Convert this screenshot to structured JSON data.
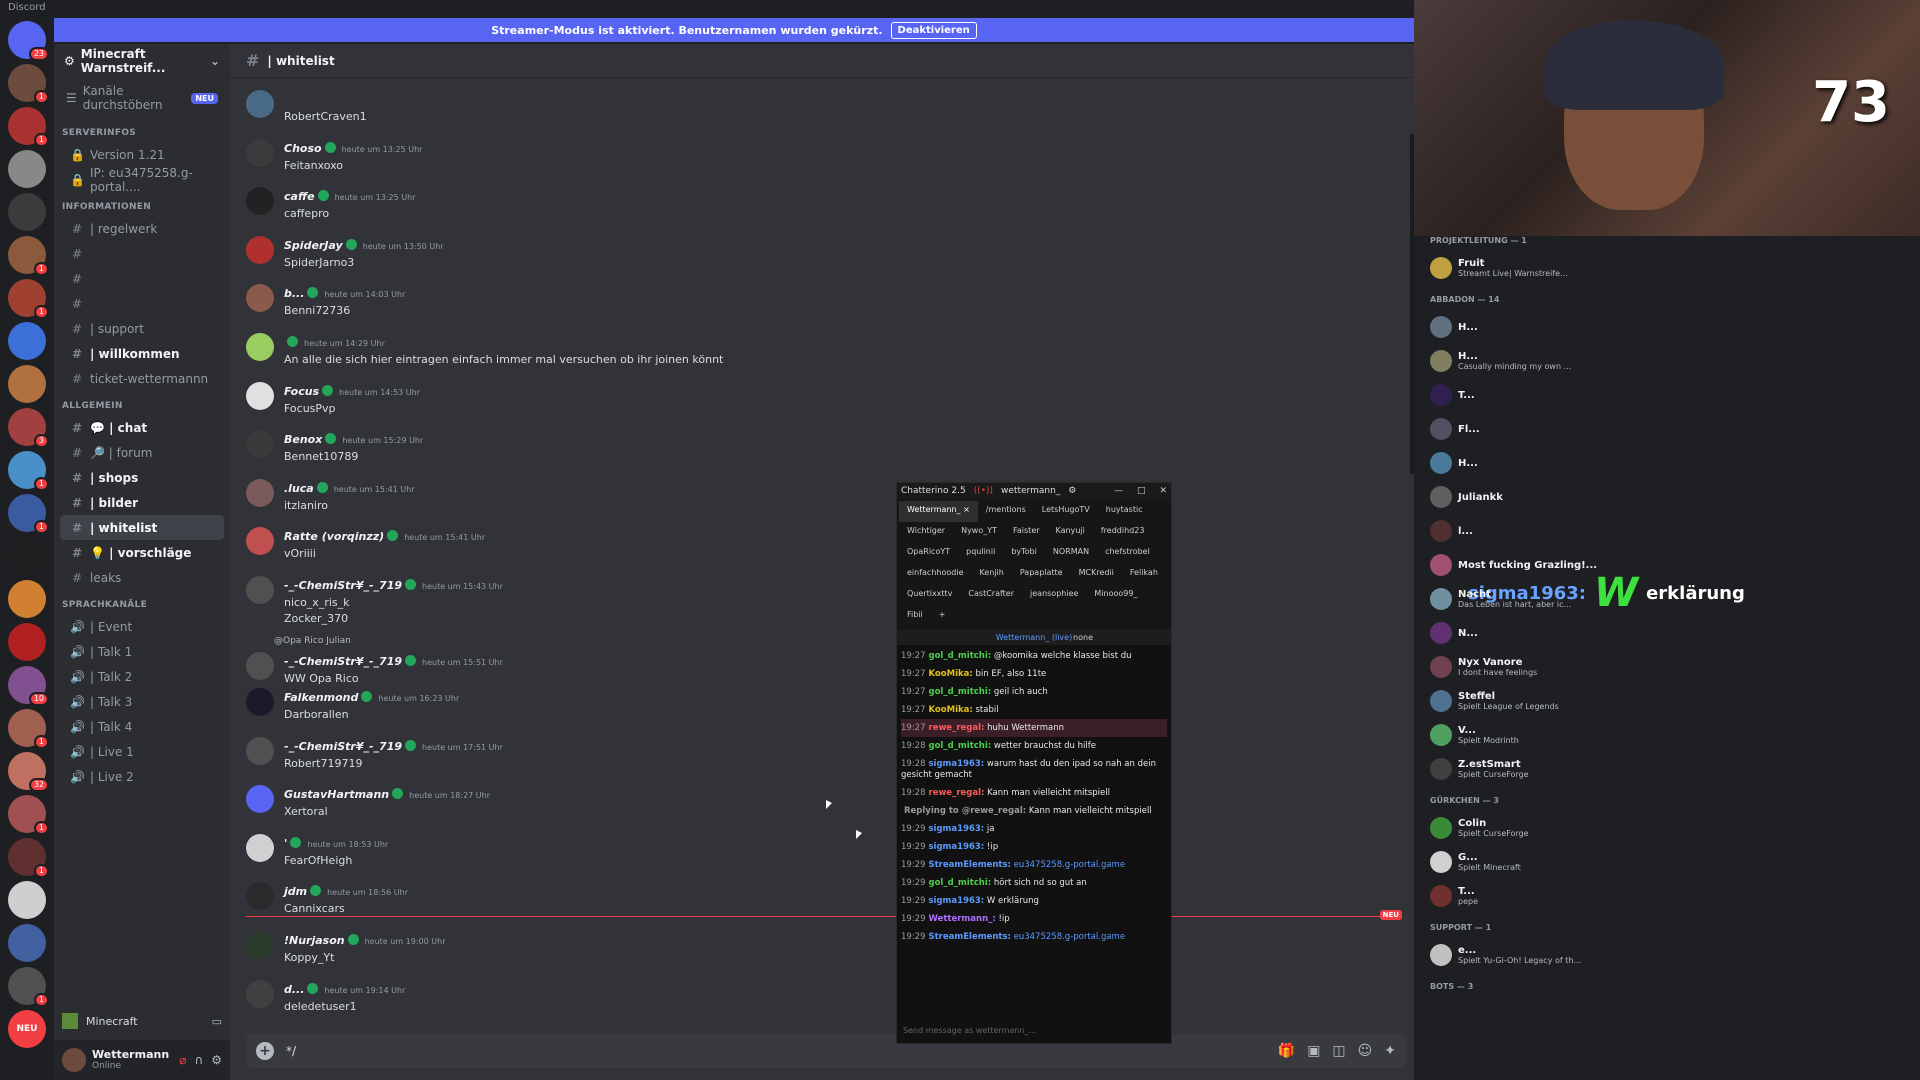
{
  "window": {
    "title": "Discord"
  },
  "banner": {
    "text": "Streamer-Modus ist aktiviert. Benutzernamen wurden gekürzt.",
    "button": "Deaktivieren"
  },
  "servers": [
    {
      "badge": "23",
      "color": "#5865f2"
    },
    {
      "badge": "1",
      "color": "#6d4c3d"
    },
    {
      "badge": "1",
      "color": "#a83232"
    },
    {
      "badge": "",
      "color": "#888888"
    },
    {
      "badge": "",
      "color": "#3b3b3b"
    },
    {
      "badge": "1",
      "color": "#8b5a3c"
    },
    {
      "badge": "1",
      "color": "#a04030"
    },
    {
      "badge": "",
      "color": "#3c6fd8"
    },
    {
      "badge": "",
      "color": "#b07040"
    },
    {
      "badge": "3",
      "color": "#a04040"
    },
    {
      "badge": "1",
      "color": "#4a90c8"
    },
    {
      "badge": "1",
      "color": "#3b5ba0"
    },
    {
      "badge": "",
      "color": "#202020"
    },
    {
      "badge": "",
      "color": "#d08030"
    },
    {
      "badge": "",
      "color": "#b02020"
    },
    {
      "badge": "10",
      "color": "#805090"
    },
    {
      "badge": "1",
      "color": "#a06050"
    },
    {
      "badge": "32",
      "color": "#c07060"
    },
    {
      "badge": "1",
      "color": "#a05050"
    },
    {
      "badge": "1",
      "color": "#603030"
    },
    {
      "badge": "",
      "color": "#cfcfcf"
    },
    {
      "badge": "",
      "color": "#4060a0"
    },
    {
      "badge": "1",
      "color": "#505050"
    }
  ],
  "servers_bottom": {
    "neu": "NEU"
  },
  "sidebar": {
    "guild_name": "Minecraft Warnstreif...",
    "browse_label": "Kanäle durchstöbern",
    "browse_tag": "NEU",
    "categories": [
      {
        "name": "SERVERINFOS",
        "channels": [
          {
            "prefix": "🔒",
            "label": "Version 1.21"
          },
          {
            "prefix": "🔒",
            "label": "IP: eu3475258.g-portal...."
          }
        ]
      },
      {
        "name": "INFORMATIONEN",
        "channels": [
          {
            "prefix": "#",
            "label": "| regelwerk"
          },
          {
            "prefix": "#",
            "label": ""
          },
          {
            "prefix": "#",
            "label": ""
          },
          {
            "prefix": "#",
            "label": ""
          },
          {
            "prefix": "#",
            "label": "| support"
          },
          {
            "prefix": "#",
            "label": "| willkommen"
          },
          {
            "prefix": "#",
            "label": "ticket-wettermannn"
          }
        ]
      },
      {
        "name": "ALLGEMEIN",
        "channels": [
          {
            "prefix": "#",
            "label": "💬 | chat"
          },
          {
            "prefix": "#",
            "label": "🔎 | forum"
          },
          {
            "prefix": "#",
            "label": "| shops"
          },
          {
            "prefix": "#",
            "label": "| bilder"
          },
          {
            "prefix": "#",
            "label": "| whitelist"
          },
          {
            "prefix": "#",
            "label": "💡 | vorschläge"
          },
          {
            "prefix": "#",
            "label": "leaks"
          }
        ]
      },
      {
        "name": "SPRACHKANÄLE",
        "channels": [
          {
            "prefix": "🔊",
            "label": "| Event"
          },
          {
            "prefix": "🔊",
            "label": "| Talk 1"
          },
          {
            "prefix": "🔊",
            "label": "| Talk 2"
          },
          {
            "prefix": "🔊",
            "label": "| Talk 3"
          },
          {
            "prefix": "🔊",
            "label": "| Talk 4"
          },
          {
            "prefix": "🔊",
            "label": "| Live 1"
          },
          {
            "prefix": "🔊",
            "label": "| Live 2"
          }
        ]
      }
    ],
    "voice_label": "Minecraft",
    "user": {
      "name": "Wettermann",
      "status": "Online"
    }
  },
  "channel": {
    "name": "| whitelist"
  },
  "messages": [
    {
      "author": "",
      "time": "",
      "text": "RobertCraven1",
      "color": "#4a6a8a"
    },
    {
      "author": "Choso",
      "time": "heute um 13:25 Uhr",
      "text": "Feitanxoxo",
      "color": "#3b3b3b"
    },
    {
      "author": "caffe",
      "time": "heute um 13:25 Uhr",
      "text": "caffepro",
      "color": "#222222"
    },
    {
      "author": "SpiderJay",
      "time": "heute um 13:50 Uhr",
      "text": "SpiderJarno3",
      "color": "#b03030"
    },
    {
      "author": "b...",
      "time": "heute um 14:03 Uhr",
      "text": "Benni72736",
      "color": "#8a5a4a"
    },
    {
      "author": "",
      "time": "heute um 14:29 Uhr",
      "text": "An alle die sich hier eintragen einfach immer mal versuchen ob ihr joinen könnt",
      "color": "#9acd60"
    },
    {
      "author": "Focus",
      "time": "heute um 14:53 Uhr",
      "text": "FocusPvp",
      "color": "#e0e0e0"
    },
    {
      "author": "Benox",
      "time": "heute um 15:29 Uhr",
      "text": "Bennet10789",
      "color": "#3a3a3a"
    },
    {
      "author": ".luca",
      "time": "heute um 15:41 Uhr",
      "text": "itzlaniro",
      "color": "#7a5a5a"
    },
    {
      "author": "Ratte (vorqinzz)",
      "time": "heute um 15:41 Uhr",
      "text": "vOriiii",
      "color": "#c05050"
    },
    {
      "author": "-_-ChemiStr¥_-_719",
      "time": "heute um 15:43 Uhr",
      "text": "nico_x_ris_k",
      "text2": "Zocker_370",
      "color": "#505050"
    },
    {
      "author": "-_-ChemiStr¥_-_719",
      "time": "heute um 15:51 Uhr",
      "text": "WW Opa Rico",
      "reply": "@Opa Rico  Julian",
      "color": "#505050"
    },
    {
      "author": "Falkenmond",
      "time": "heute um 16:23 Uhr",
      "text": "Darborallen",
      "color": "#1a1a2a"
    },
    {
      "author": "-_-ChemiStr¥_-_719",
      "time": "heute um 17:51 Uhr",
      "text": "Robert719719",
      "color": "#505050"
    },
    {
      "author": "GustavHartmann",
      "time": "heute um 18:27 Uhr",
      "text": "Xertoral",
      "color": "#5865f2"
    },
    {
      "author": "'",
      "time": "heute um 18:53 Uhr",
      "text": "FearOfHeigh",
      "color": "#d0d0d0"
    },
    {
      "author": "jdm",
      "time": "heute um 18:56 Uhr",
      "text": "Cannixcars",
      "color": "#2a2a2a"
    },
    {
      "author": "!Nurjason",
      "time": "heute um 19:00 Uhr",
      "text": "Koppy_Yt",
      "color": "#2a3a2a"
    },
    {
      "author": "d...",
      "time": "heute um 19:14 Uhr",
      "text": "deledetuser1",
      "color": "#404040"
    }
  ],
  "new_tag": "NEU",
  "composer": {
    "value": "*/"
  },
  "overlay": {
    "user": "sigma1963:",
    "emote": "W",
    "text": "erklärung",
    "counter": "73"
  },
  "chatterino": {
    "title": "Chatterino 2.5",
    "channel": "wettermann_",
    "tabs": [
      "Wettermann_ ×",
      "/mentions",
      "LetsHugoTV",
      "huytastic",
      "Wichtiger",
      "Nywo_YT",
      "Faister",
      "Kanyuji",
      "freddihd23",
      "OpaRicoYT",
      "pqulinii",
      "byTobi",
      "NORMAN",
      "chefstrobel",
      "einfachhoodie",
      "Kenjih",
      "Papaplatte",
      "MCKredii",
      "Felikah",
      "Quertixxttv",
      "CastCrafter",
      "jeansophiee",
      "Minooo99_",
      "Fibii",
      "+"
    ],
    "sub": "Wettermann_ (live)",
    "sub_none": "none",
    "lines": [
      {
        "t": "19:27",
        "u": "gol_d_mitchi:",
        "uc": "#4ccf4c",
        "m": "@koomika welche klasse bist du"
      },
      {
        "t": "19:27",
        "u": "KooMika:",
        "uc": "#e0c020",
        "m": "bin EF, also 11te"
      },
      {
        "t": "19:27",
        "u": "gol_d_mitchi:",
        "uc": "#4ccf4c",
        "m": "geil ich auch"
      },
      {
        "t": "19:27",
        "u": "KooMika:",
        "uc": "#e0c020",
        "m": "stabil"
      },
      {
        "t": "19:27",
        "u": "rewe_regal:",
        "uc": "#ff5a5a",
        "m": "huhu Wettermann",
        "hl": true
      },
      {
        "t": "19:28",
        "u": "gol_d_mitchi:",
        "uc": "#4ccf4c",
        "m": "wetter brauchst du hilfe"
      },
      {
        "t": "19:28",
        "u": "sigma1963:",
        "uc": "#5b9bff",
        "m": "warum hast du den ipad so nah an dein gesicht gemacht"
      },
      {
        "t": "19:28",
        "u": "rewe_regal:",
        "uc": "#ff5a5a",
        "m": "Kann man vielleicht mitspiell"
      },
      {
        "t": "",
        "u": "Replying to @rewe_regal:",
        "uc": "#9a9a9a",
        "m": "Kann man vielleicht mitspiell"
      },
      {
        "t": "19:29",
        "u": "sigma1963:",
        "uc": "#5b9bff",
        "m": "ja"
      },
      {
        "t": "19:29",
        "u": "sigma1963:",
        "uc": "#5b9bff",
        "m": "!ip"
      },
      {
        "t": "19:29",
        "u": "StreamElements:",
        "uc": "#5b9bff",
        "m": "eu3475258.g-portal.game"
      },
      {
        "t": "19:29",
        "u": "gol_d_mitchi:",
        "uc": "#4ccf4c",
        "m": "hört sich nd so gut an"
      },
      {
        "t": "19:29",
        "u": "sigma1963:",
        "uc": "#5b9bff",
        "m": "W erklärung"
      },
      {
        "t": "19:29",
        "u": "Wettermann_:",
        "uc": "#b070ff",
        "m": "!ip"
      },
      {
        "t": "19:29",
        "u": "StreamElements:",
        "uc": "#5b9bff",
        "m": "eu3475258.g-portal.game"
      }
    ],
    "input_placeholder": "Send message as wettermann_..."
  },
  "members": {
    "categories": [
      {
        "name": "PROJEKTLEITUNG — 1",
        "items": [
          {
            "name": "Fruit",
            "activity": "Streamt Live| Warnstreife...",
            "color": "#c0a040"
          }
        ]
      },
      {
        "name": "ABBADON — 14",
        "items": [
          {
            "name": "H...",
            "activity": "",
            "color": "#607080"
          },
          {
            "name": "H...",
            "activity": "Casually minding my own ...",
            "color": "#808060"
          },
          {
            "name": "T...",
            "activity": "",
            "color": "#302050"
          },
          {
            "name": "Fl...",
            "activity": "",
            "color": "#505060"
          },
          {
            "name": "H...",
            "activity": "",
            "color": "#4a7a9a"
          },
          {
            "name": "Juliankk",
            "activity": "",
            "color": "#606060"
          },
          {
            "name": "l...",
            "activity": "",
            "color": "#503030"
          },
          {
            "name": "Most fucking Grazling!...",
            "activity": "",
            "color": "#a05070"
          },
          {
            "name": "Nacht",
            "activity": "Das Leben ist hart, aber ic...",
            "color": "#7090a0"
          },
          {
            "name": "N...",
            "activity": "",
            "color": "#603070"
          },
          {
            "name": "Nyx Vanore",
            "activity": "I dont have feelings",
            "color": "#704050"
          },
          {
            "name": "Steffel",
            "activity": "Spielt League of Legends",
            "color": "#507090"
          },
          {
            "name": "V...",
            "activity": "Spielt Modrinth",
            "color": "#50a060"
          },
          {
            "name": "Z.estSmart",
            "activity": "Spielt CurseForge",
            "color": "#404040"
          }
        ]
      },
      {
        "name": "GÜRKCHEN — 3",
        "items": [
          {
            "name": "Colin",
            "activity": "Spielt CurseForge",
            "color": "#3a8a3a"
          },
          {
            "name": "G...",
            "activity": "Spielt Minecraft",
            "color": "#d0d0d0"
          },
          {
            "name": "T...",
            "activity": "pepe",
            "color": "#703030"
          }
        ]
      },
      {
        "name": "SUPPORT — 1",
        "items": [
          {
            "name": "e...",
            "activity": "Spielt Yu-Gi-Oh! Legacy of th...",
            "color": "#c0c0c0"
          }
        ]
      },
      {
        "name": "BOTS — 3",
        "items": []
      }
    ]
  },
  "colors": {
    "blurple": "#5865f2",
    "green": "#23a55a",
    "red": "#f23f43"
  }
}
